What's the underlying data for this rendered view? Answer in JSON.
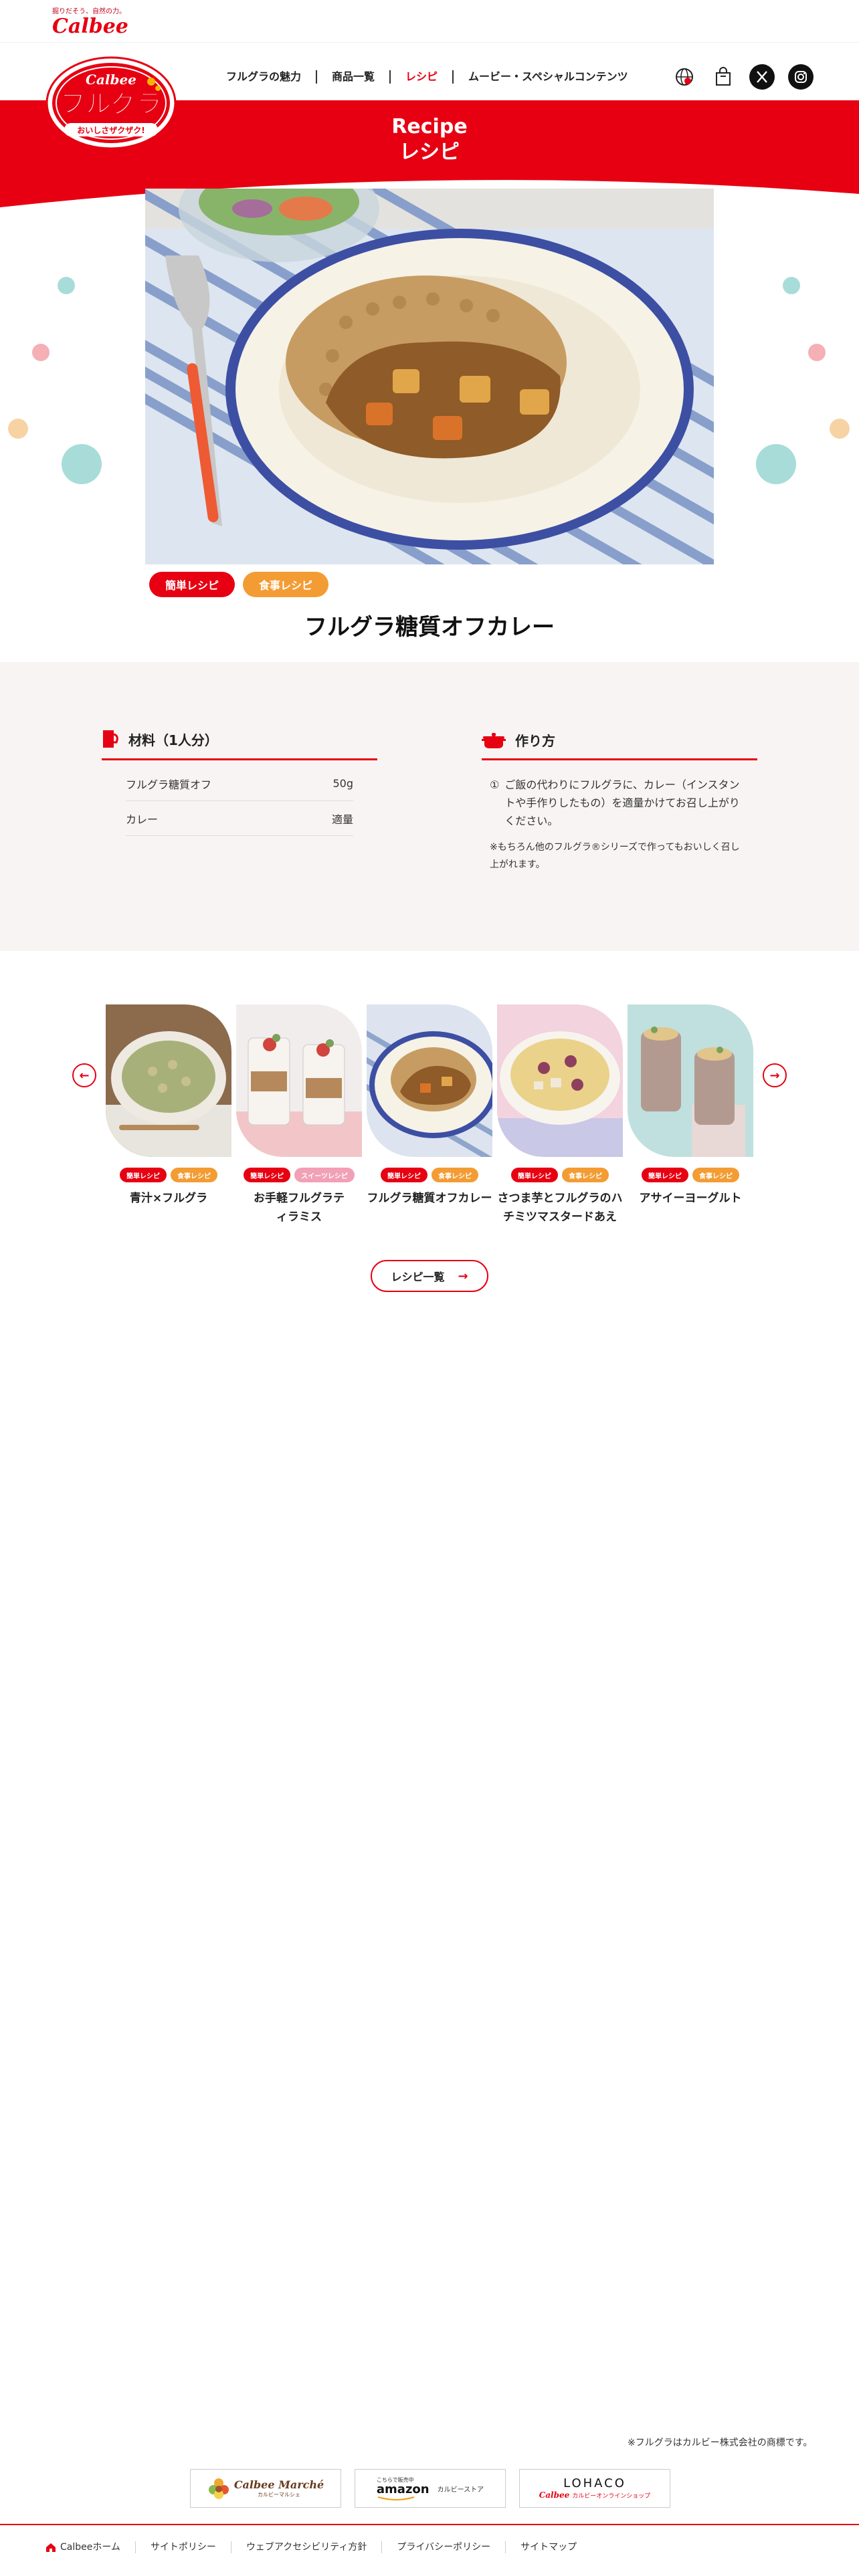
{
  "corporate": {
    "tagline": "掘りだそう、自然の力。",
    "wordmark": "Calbee"
  },
  "brand": {
    "logo_top": "Calbee",
    "logo_main": "フルグラ",
    "logo_sub": "おいしさザクザク!"
  },
  "nav": {
    "items": [
      {
        "label": "フルグラの魅力",
        "active": false
      },
      {
        "label": "商品一覧",
        "active": false
      },
      {
        "label": "レシピ",
        "active": true
      },
      {
        "label": "ムービー・スペシャルコンテンツ",
        "active": false
      }
    ]
  },
  "header_icons": [
    "globe-icon",
    "shopping-bag-icon",
    "x-social-icon",
    "instagram-icon"
  ],
  "hero": {
    "title_en": "Recipe",
    "title_jp": "レシピ"
  },
  "recipe": {
    "tags": [
      {
        "label": "簡単レシピ",
        "color": "#e60012"
      },
      {
        "label": "食事レシピ",
        "color": "#f39c34"
      }
    ],
    "title": "フルグラ糖質オフカレー",
    "ingredients_title": "材料（1人分）",
    "ingredients": [
      {
        "name": "フルグラ糖質オフ",
        "amount": "50g"
      },
      {
        "name": "カレー",
        "amount": "適量"
      }
    ],
    "method_title": "作り方",
    "steps": [
      {
        "num": "①",
        "text": "ご飯の代わりにフルグラに、カレー（インスタントや手作りしたもの）を適量かけてお召し上がりください。"
      }
    ],
    "note": "※もちろん他のフルグラ®シリーズで作ってもおいしく召し上がれます。"
  },
  "related": {
    "cards": [
      {
        "name": "青汁×フルグラ",
        "tags": [
          {
            "label": "簡単レシピ",
            "color": "red"
          },
          {
            "label": "食事レシピ",
            "color": "orange"
          }
        ]
      },
      {
        "name": "お手軽フルグラティラミス",
        "tags": [
          {
            "label": "簡単レシピ",
            "color": "red"
          },
          {
            "label": "スイーツレシピ",
            "color": "pink"
          }
        ]
      },
      {
        "name": "フルグラ糖質オフカレー",
        "tags": [
          {
            "label": "簡単レシピ",
            "color": "red"
          },
          {
            "label": "食事レシピ",
            "color": "orange"
          }
        ]
      },
      {
        "name": "さつま芋とフルグラのハチミツマスタードあえ",
        "tags": [
          {
            "label": "簡単レシピ",
            "color": "red"
          },
          {
            "label": "食事レシピ",
            "color": "orange"
          }
        ]
      },
      {
        "name": "アサイーヨーグルト",
        "tags": [
          {
            "label": "簡単レシピ",
            "color": "red"
          },
          {
            "label": "食事レシピ",
            "color": "orange"
          }
        ]
      }
    ],
    "list_button": "レシピ一覧"
  },
  "footer": {
    "trademark": "※フルグラはカルビー株式会社の商標です。",
    "partners": [
      {
        "name": "Calbee Marché",
        "sub": "カルビーマルシェ"
      },
      {
        "name": "amazon",
        "pre": "こちらで販売中",
        "sub": "カルビーストア"
      },
      {
        "name": "LOHACO",
        "sub": "カルビーオンラインショップ",
        "sub_brand": "Calbee"
      }
    ],
    "links": [
      "Calbeeホーム",
      "サイトポリシー",
      "ウェブアクセシビリティ方針",
      "プライバシーポリシー",
      "サイトマップ"
    ]
  },
  "colors": {
    "brand_red": "#e60012",
    "orange": "#f39c34",
    "section_bg": "#f8f4f3"
  }
}
